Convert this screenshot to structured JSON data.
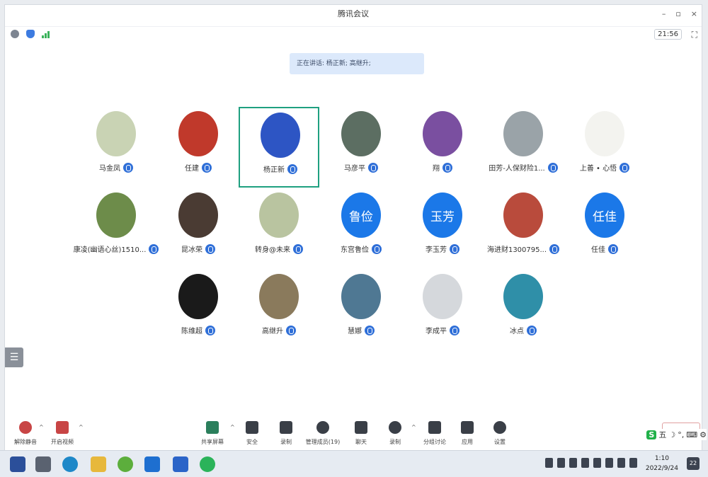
{
  "window": {
    "title": "腾讯会议",
    "controls": [
      "–",
      "▫",
      "×"
    ]
  },
  "status": {
    "time": "21:56"
  },
  "speaking": {
    "text": "正在讲话: 杨正新; 高继升;"
  },
  "participants": [
    {
      "name": "马金凤",
      "avatar_color": "#c9d3b4"
    },
    {
      "name": "任建",
      "avatar_color": "#c0392b"
    },
    {
      "name": "杨正新",
      "avatar_color": "#2d55c4",
      "active": true
    },
    {
      "name": "马彦平",
      "avatar_color": "#5c6e62"
    },
    {
      "name": "翔",
      "avatar_color": "#7a4fa0"
    },
    {
      "name": "田芳-人保财险1...",
      "avatar_color": "#9aa3a8"
    },
    {
      "name": "上善 • 心悟",
      "avatar_color": "#f3f3ef"
    },
    {
      "name": "康凌(幽语心丝)1510...",
      "avatar_color": "#6d8c4a"
    },
    {
      "name": "昆冰荣",
      "avatar_color": "#4a3b33"
    },
    {
      "name": "转身@未来",
      "avatar_color": "#b9c4a0"
    },
    {
      "name": "东宫鲁俭",
      "avatar_color": "#1b78e8",
      "avatar_text": "鲁俭"
    },
    {
      "name": "李玉芳",
      "avatar_color": "#1b78e8",
      "avatar_text": "玉芳"
    },
    {
      "name": "海进财1300795...",
      "avatar_color": "#b94b3c"
    },
    {
      "name": "任佳",
      "avatar_color": "#1b78e8",
      "avatar_text": "任佳"
    },
    {
      "name": "陈维超",
      "avatar_color": "#1a1a1a"
    },
    {
      "name": "高继升",
      "avatar_color": "#8a7a5c"
    },
    {
      "name": "慧娜",
      "avatar_color": "#4f7893"
    },
    {
      "name": "李成平",
      "avatar_color": "#d5d8dc"
    },
    {
      "name": "冰点",
      "avatar_color": "#2f8fa8"
    }
  ],
  "toolbar": {
    "unmute": "解除静音",
    "video": "开启视频",
    "share": "共享屏幕",
    "security": "安全",
    "record": "录制",
    "members": "管理成员(19)",
    "chat": "聊天",
    "record_cloud": "录制",
    "breakout": "分组讨论",
    "apps": "应用",
    "settings": "设置"
  },
  "ime": {
    "label": "五"
  },
  "taskbar": {
    "time": "1:10",
    "date": "2022/9/24",
    "notif": "22"
  }
}
